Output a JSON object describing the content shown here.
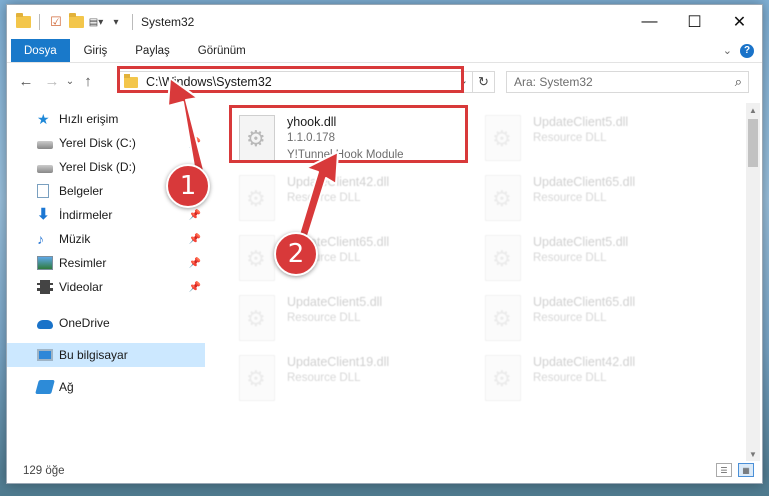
{
  "window": {
    "title": "System32",
    "controls": {
      "minimize": "—",
      "maximize": "☐",
      "close": "✕"
    }
  },
  "ribbon": {
    "tabs": [
      "Dosya",
      "Giriş",
      "Paylaş",
      "Görünüm"
    ],
    "collapse_icon": "chevron-down-icon",
    "help_label": "?"
  },
  "nav": {
    "back": "←",
    "forward": "→",
    "recent": "⌄",
    "up": "↑",
    "address": "C:\\Windows\\System32",
    "address_dropdown": "⌄",
    "refresh": "↻",
    "search_placeholder": "Ara: System32",
    "search_icon": "⌕"
  },
  "sidebar": {
    "items": [
      {
        "label": "Hızlı erişim",
        "icon": "star-icon",
        "pinned": false
      },
      {
        "label": "Yerel Disk (C:)",
        "icon": "disk-icon",
        "pinned": true
      },
      {
        "label": "Yerel Disk (D:)",
        "icon": "disk-icon",
        "pinned": true
      },
      {
        "label": "Belgeler",
        "icon": "documents-icon",
        "pinned": true
      },
      {
        "label": "İndirmeler",
        "icon": "download-icon",
        "pinned": true
      },
      {
        "label": "Müzik",
        "icon": "music-icon",
        "pinned": true
      },
      {
        "label": "Resimler",
        "icon": "pictures-icon",
        "pinned": true
      },
      {
        "label": "Videolar",
        "icon": "videos-icon",
        "pinned": true
      },
      {
        "label": "OneDrive",
        "icon": "cloud-icon",
        "pinned": false
      },
      {
        "label": "Bu bilgisayar",
        "icon": "computer-icon",
        "pinned": false,
        "selected": true
      },
      {
        "label": "Ağ",
        "icon": "network-icon",
        "pinned": false
      }
    ],
    "pin_glyph": "📌"
  },
  "files": {
    "highlighted": {
      "name": "yhook.dll",
      "version": "1.1.0.178",
      "description": "Y!Tunnel Hook Module"
    },
    "background": [
      {
        "name": "UpdateClient5.dll",
        "type": "Resource DLL"
      },
      {
        "name": "UpdateClient42.dll",
        "type": "Resource DLL"
      },
      {
        "name": "UpdateClient65.dll",
        "type": "Resource DLL"
      },
      {
        "name": "UpdateClient65.dll",
        "type": "Resource DLL"
      },
      {
        "name": "UpdateClient5.dll",
        "type": "Resource DLL"
      },
      {
        "name": "UpdateClient5.dll",
        "type": "Resource DLL"
      },
      {
        "name": "UpdateClient65.dll",
        "type": "Resource DLL"
      },
      {
        "name": "UpdateClient19.dll",
        "type": "Resource DLL"
      },
      {
        "name": "UpdateClient42.dll",
        "type": "Resource DLL"
      }
    ]
  },
  "status": {
    "item_count": "129 öğe"
  },
  "annotations": {
    "step1": "1",
    "step2": "2",
    "color": "#d8393a"
  }
}
